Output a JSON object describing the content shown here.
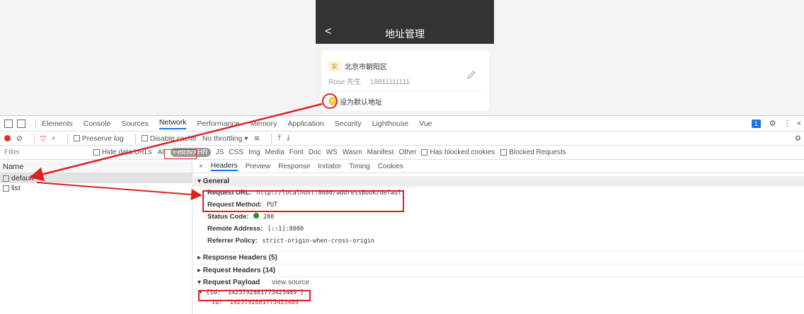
{
  "phone": {
    "back": "<",
    "title": "地址管理",
    "address": {
      "tag": "家",
      "location": "北京市朝阳区",
      "name": "Rose 先生",
      "phone": "18811111111",
      "default_label": "设为默认地址"
    }
  },
  "devtools": {
    "tabs": [
      "Elements",
      "Console",
      "Sources",
      "Network",
      "Performance",
      "Memory",
      "Application",
      "Security",
      "Lighthouse",
      "Vue"
    ],
    "active_tab": "Network",
    "badge_count": "1",
    "toolbar": {
      "preserve_log": "Preserve log",
      "disable_cache": "Disable cache",
      "throttling": "No throttling"
    },
    "filter": {
      "placeholder": "Filter",
      "hide_data_urls": "Hide data URLs",
      "types": [
        "All",
        "Fetch/XHR",
        "JS",
        "CSS",
        "Img",
        "Media",
        "Font",
        "Doc",
        "WS",
        "Wasm",
        "Manifest",
        "Other"
      ],
      "active_type": "Fetch/XHR",
      "has_blocked_cookies": "Has blocked cookies",
      "blocked_requests": "Blocked Requests"
    },
    "name_column": {
      "header": "Name",
      "requests": [
        "default",
        "list"
      ]
    },
    "detail_tabs": [
      "×",
      "Headers",
      "Preview",
      "Response",
      "Initiator",
      "Timing",
      "Cookies"
    ],
    "general": {
      "title": "▾ General",
      "request_url_label": "Request URL:",
      "request_url": "http://localhost:8080/addressBook/default",
      "request_method_label": "Request Method:",
      "request_method": "PUT",
      "status_code_label": "Status Code:",
      "status_code": "200",
      "remote_address_label": "Remote Address:",
      "remote_address": "[::1]:8080",
      "referrer_policy_label": "Referrer Policy:",
      "referrer_policy": "strict-origin-when-cross-origin"
    },
    "response_headers": "▸ Response Headers (5)",
    "request_headers": "▸ Request Headers (14)",
    "payload": {
      "title": "▾ Request Payload",
      "view_source": "view source",
      "object": "▾ {id: \"1425792881775423489\"}",
      "prop_key": "id: ",
      "prop_value": "\"1425792881775423489\""
    }
  }
}
